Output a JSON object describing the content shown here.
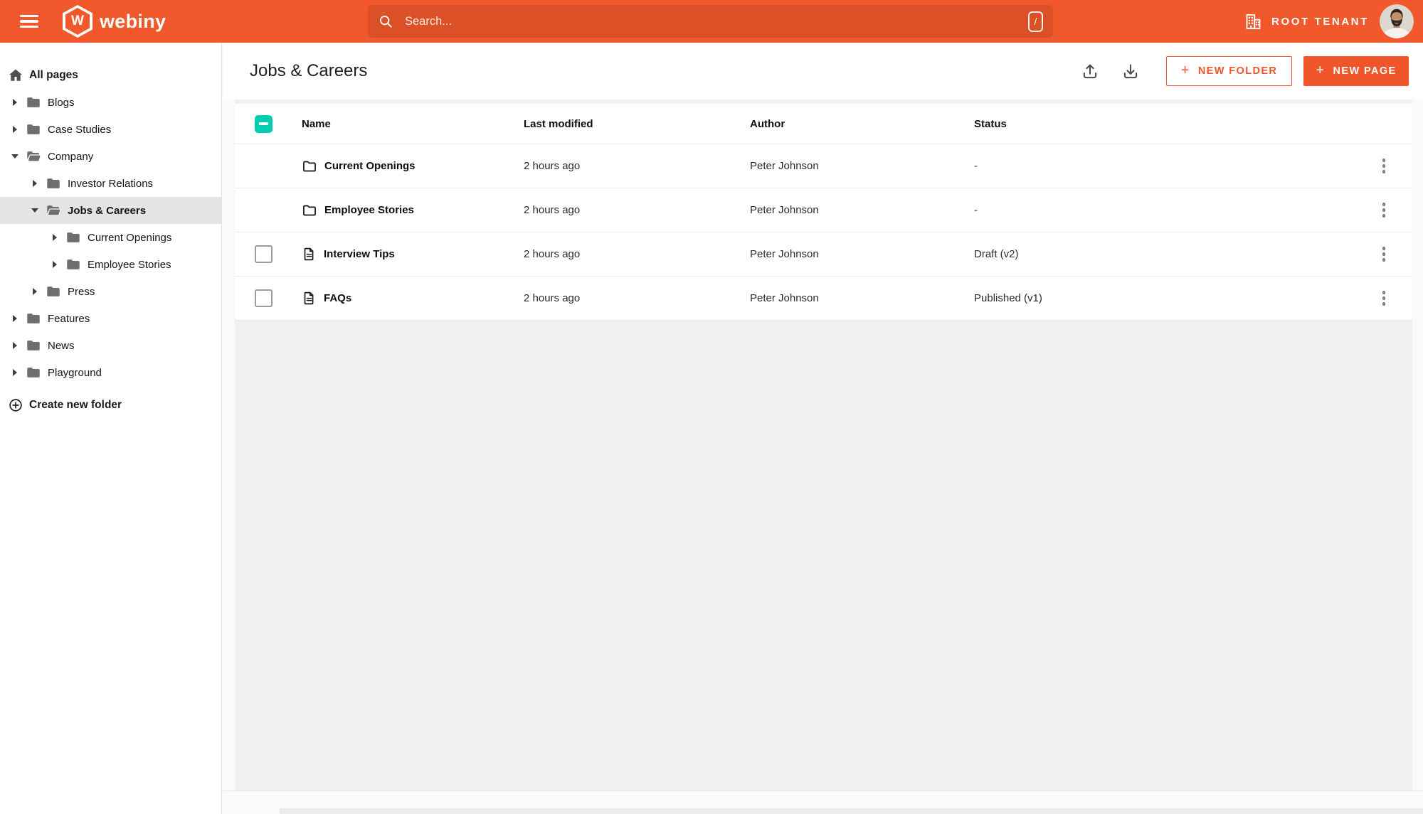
{
  "colors": {
    "topbar_orange": "#F1582B",
    "accent_orange": "#F0552A",
    "checkbox_teal": "#00CCB0",
    "sidebar_selected_bg": "#E4E4E4"
  },
  "topbar": {
    "brand": "webiny",
    "logo_letter": "W",
    "search": {
      "placeholder": "Search...",
      "shortcut_key": "/"
    },
    "tenant_label": "ROOT TENANT"
  },
  "sidebar": {
    "root_label": "All pages",
    "items": [
      {
        "label": "Blogs",
        "level": 1,
        "expanded": false,
        "selected": false
      },
      {
        "label": "Case Studies",
        "level": 1,
        "expanded": false,
        "selected": false
      },
      {
        "label": "Company",
        "level": 1,
        "expanded": true,
        "selected": false
      },
      {
        "label": "Investor Relations",
        "level": 2,
        "expanded": false,
        "selected": false
      },
      {
        "label": "Jobs & Careers",
        "level": 2,
        "expanded": true,
        "selected": true
      },
      {
        "label": "Current Openings",
        "level": 3,
        "expanded": false,
        "selected": false
      },
      {
        "label": "Employee Stories",
        "level": 3,
        "expanded": false,
        "selected": false
      },
      {
        "label": "Press",
        "level": 2,
        "expanded": false,
        "selected": false
      },
      {
        "label": "Features",
        "level": 1,
        "expanded": false,
        "selected": false
      },
      {
        "label": "News",
        "level": 1,
        "expanded": false,
        "selected": false
      },
      {
        "label": "Playground",
        "level": 1,
        "expanded": false,
        "selected": false
      }
    ],
    "create_folder_label": "Create new folder"
  },
  "content": {
    "title": "Jobs & Careers",
    "toolbar": {
      "plus": "+",
      "new_folder_label": "NEW FOLDER",
      "new_page_label": "NEW PAGE"
    },
    "table": {
      "columns": [
        "Name",
        "Last modified",
        "Author",
        "Status"
      ],
      "header_checkbox_state": "indeterminate",
      "rows": [
        {
          "type": "folder",
          "name": "Current Openings",
          "last_modified": "2 hours ago",
          "author": "Peter Johnson",
          "status": "-",
          "has_checkbox": false,
          "checked": false
        },
        {
          "type": "folder",
          "name": "Employee Stories",
          "last_modified": "2 hours ago",
          "author": "Peter Johnson",
          "status": "-",
          "has_checkbox": false,
          "checked": false
        },
        {
          "type": "page",
          "name": "Interview Tips",
          "last_modified": "2 hours ago",
          "author": "Peter Johnson",
          "status": "Draft (v2)",
          "has_checkbox": true,
          "checked": false
        },
        {
          "type": "page",
          "name": "FAQs",
          "last_modified": "2 hours ago",
          "author": "Peter Johnson",
          "status": "Published (v1)",
          "has_checkbox": true,
          "checked": false
        }
      ]
    }
  },
  "icons": [
    "hamburger-menu-icon",
    "webiny-logo",
    "search-icon",
    "slash-shortcut-badge",
    "tenant-building-icon",
    "user-avatar",
    "home-icon",
    "folder-icon",
    "folder-open-icon",
    "chevron-right-icon",
    "chevron-down-icon",
    "create-folder-plus-icon",
    "upload-icon",
    "download-icon",
    "select-all-checkbox",
    "row-checkbox",
    "folder-outline-icon",
    "page-icon",
    "kebab-menu-icon"
  ]
}
